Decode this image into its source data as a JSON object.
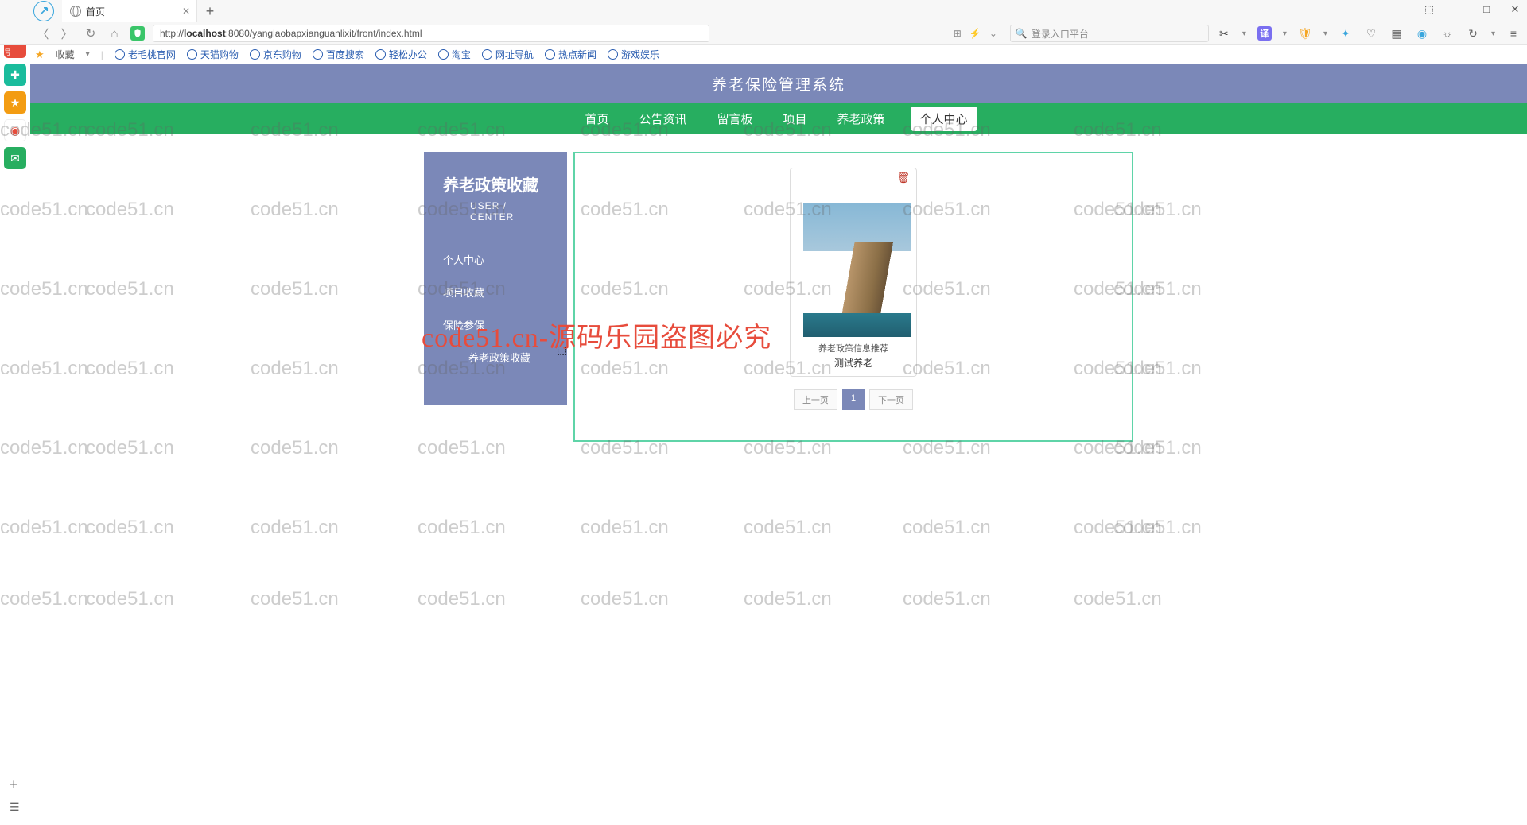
{
  "browser": {
    "tab_title": "首页",
    "url_prefix": "http://",
    "url_host": "localhost",
    "url_rest": ":8080/yanglaobapxianguanlixit/front/index.html",
    "search_placeholder": "登录入口平台",
    "favorites_label": "收藏",
    "bookmarks": [
      "老毛桃官网",
      "天猫购物",
      "京东购物",
      "百度搜索",
      "轻松办公",
      "淘宝",
      "网址导航",
      "热点新闻",
      "游戏娱乐"
    ]
  },
  "header": {
    "title": "养老保险管理系统"
  },
  "nav": {
    "items": [
      "首页",
      "公告资讯",
      "留言板",
      "项目",
      "养老政策",
      "个人中心"
    ],
    "active": "个人中心"
  },
  "sidebar": {
    "title": "养老政策收藏",
    "subtitle": "USER / CENTER",
    "items": [
      "个人中心",
      "项目收藏",
      "保险参保",
      "养老政策收藏"
    ]
  },
  "card": {
    "label": "养老政策信息推荐",
    "title": "测试养老"
  },
  "pager": {
    "prev": "上一页",
    "page": "1",
    "next": "下一页"
  },
  "watermark": {
    "small": "code51.cn",
    "big": "code51.cn-源码乐园盗图必究"
  }
}
